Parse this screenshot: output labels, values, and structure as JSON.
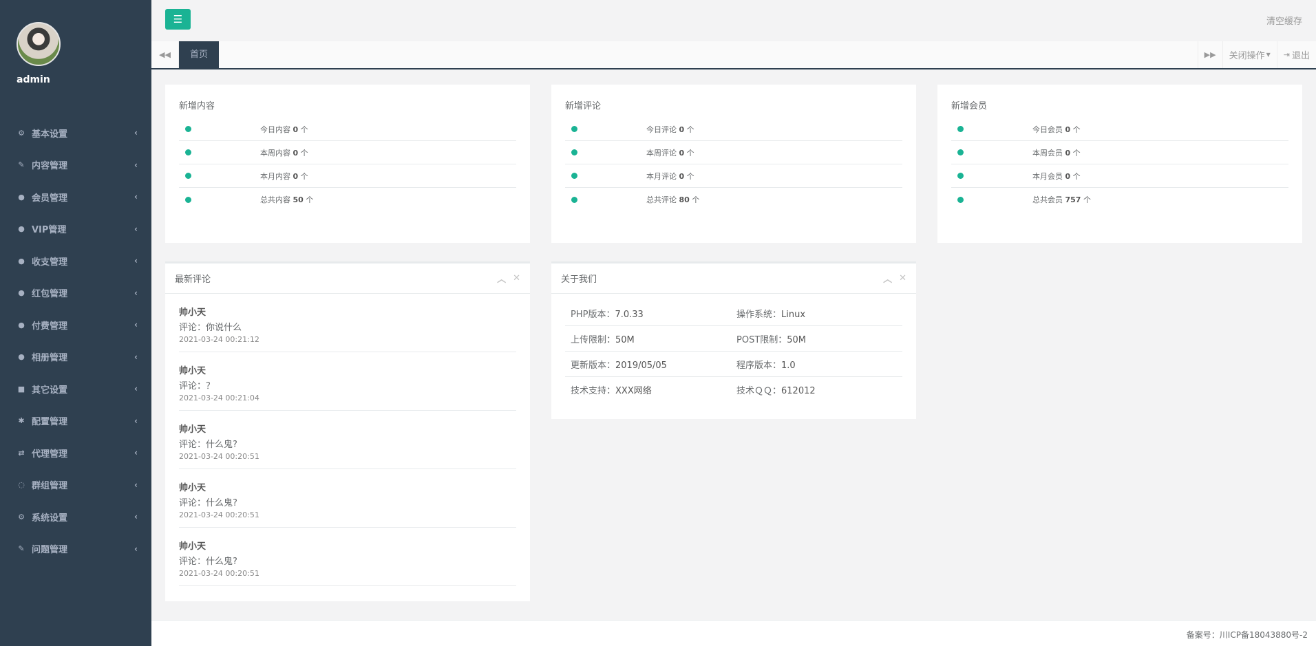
{
  "sidebar": {
    "username": "admin",
    "items": [
      {
        "label": "基本设置",
        "icon": "gear-icon",
        "glyph": "⚙"
      },
      {
        "label": "内容管理",
        "icon": "edit-icon",
        "glyph": "✎"
      },
      {
        "label": "会员管理",
        "icon": "user-icon",
        "glyph": "●"
      },
      {
        "label": "VIP管理",
        "icon": "user-icon",
        "glyph": "●"
      },
      {
        "label": "收支管理",
        "icon": "user-icon",
        "glyph": "●"
      },
      {
        "label": "红包管理",
        "icon": "user-icon",
        "glyph": "●"
      },
      {
        "label": "付费管理",
        "icon": "user-icon",
        "glyph": "●"
      },
      {
        "label": "相册管理",
        "icon": "user-icon",
        "glyph": "●"
      },
      {
        "label": "其它设置",
        "icon": "book-icon",
        "glyph": "■"
      },
      {
        "label": "配置管理",
        "icon": "asterisk-icon",
        "glyph": "✱"
      },
      {
        "label": "代理管理",
        "icon": "exchange-icon",
        "glyph": "⇄"
      },
      {
        "label": "群组管理",
        "icon": "comment-icon",
        "glyph": "◌"
      },
      {
        "label": "系统设置",
        "icon": "gears-icon",
        "glyph": "⚙"
      },
      {
        "label": "问题管理",
        "icon": "edit-icon",
        "glyph": "✎"
      }
    ]
  },
  "topbar": {
    "clear_cache": "清空缓存"
  },
  "tabs": {
    "active": "首页",
    "close_ops": "关闭操作",
    "logout": "退出"
  },
  "stats": [
    {
      "title": "新增内容",
      "rows": [
        {
          "label": "今日内容",
          "value": "0",
          "unit": "个"
        },
        {
          "label": "本周内容",
          "value": "0",
          "unit": "个"
        },
        {
          "label": "本月内容",
          "value": "0",
          "unit": "个"
        },
        {
          "label": "总共内容",
          "value": "50",
          "unit": "个"
        }
      ]
    },
    {
      "title": "新增评论",
      "rows": [
        {
          "label": "今日评论",
          "value": "0",
          "unit": "个"
        },
        {
          "label": "本周评论",
          "value": "0",
          "unit": "个"
        },
        {
          "label": "本月评论",
          "value": "0",
          "unit": "个"
        },
        {
          "label": "总共评论",
          "value": "80",
          "unit": "个"
        }
      ]
    },
    {
      "title": "新增会员",
      "rows": [
        {
          "label": "今日会员",
          "value": "0",
          "unit": "个"
        },
        {
          "label": "本周会员",
          "value": "0",
          "unit": "个"
        },
        {
          "label": "本月会员",
          "value": "0",
          "unit": "个"
        },
        {
          "label": "总共会员",
          "value": "757",
          "unit": "个"
        }
      ]
    }
  ],
  "comments_panel": {
    "title": "最新评论",
    "items": [
      {
        "name": "帅小天",
        "text": "评论：你说什么",
        "time": "2021-03-24 00:21:12"
      },
      {
        "name": "帅小天",
        "text": "评论：？",
        "time": "2021-03-24 00:21:04"
      },
      {
        "name": "帅小天",
        "text": "评论：什么鬼?",
        "time": "2021-03-24 00:20:51"
      },
      {
        "name": "帅小天",
        "text": "评论：什么鬼?",
        "time": "2021-03-24 00:20:51"
      },
      {
        "name": "帅小天",
        "text": "评论：什么鬼?",
        "time": "2021-03-24 00:20:51"
      }
    ]
  },
  "about_panel": {
    "title": "关于我们",
    "rows": [
      [
        {
          "label": "PHP版本：",
          "value": "7.0.33"
        },
        {
          "label": "操作系统：",
          "value": "Linux"
        }
      ],
      [
        {
          "label": "上传限制：",
          "value": "50M"
        },
        {
          "label": "POST限制：",
          "value": "50M"
        }
      ],
      [
        {
          "label": "更新版本：",
          "value": "2019/05/05"
        },
        {
          "label": "程序版本：",
          "value": "1.0"
        }
      ],
      [
        {
          "label": "技术支持：",
          "value": "XXX网络"
        },
        {
          "label": "技术ＱＱ：",
          "value": "612012"
        }
      ]
    ]
  },
  "footer": {
    "icp": "备案号：川ICP备18043880号-2"
  },
  "colors": {
    "sidebar_bg": "#2f4050",
    "accent": "#1ab394"
  }
}
